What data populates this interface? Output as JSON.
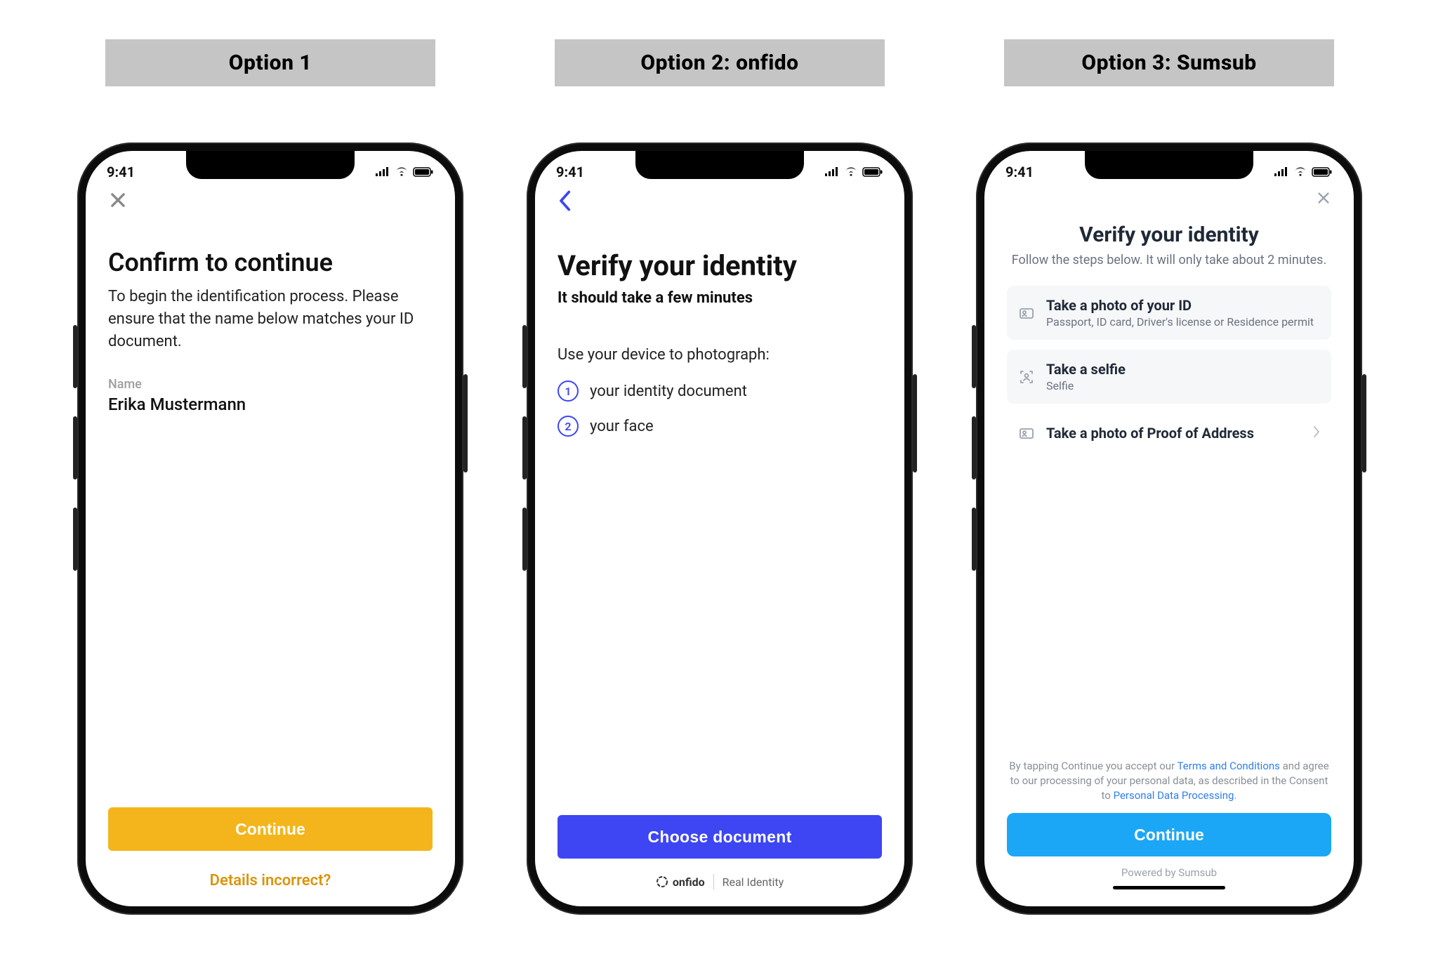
{
  "status": {
    "time": "9:41"
  },
  "options": {
    "opt1": {
      "label": "Option 1",
      "title": "Confirm to continue",
      "desc": "To begin the identification process. Please ensure that the name below matches your ID document.",
      "name_label": "Name",
      "name_value": "Erika Mustermann",
      "cta": "Continue",
      "secondary": "Details incorrect?"
    },
    "opt2": {
      "label": "Option 2: onfido",
      "title": "Verify your identity",
      "subtitle": "It should take a few minutes",
      "lead": "Use your device to photograph:",
      "steps": [
        "your identity document",
        "your face"
      ],
      "cta": "Choose document",
      "brand": "onfido",
      "brand_tag": "Real Identity"
    },
    "opt3": {
      "label": "Option 3: Sumsub",
      "title": "Verify your identity",
      "subtitle": "Follow the steps below. It will only take about 2 minutes.",
      "items": [
        {
          "title": "Take a photo of your ID",
          "sub": "Passport, ID card, Driver's license or Residence permit"
        },
        {
          "title": "Take a selfie",
          "sub": "Selfie"
        },
        {
          "title": "Take a photo of Proof of Address",
          "sub": ""
        }
      ],
      "legal_pre": "By tapping Continue you accept our ",
      "legal_terms": "Terms and Conditions",
      "legal_mid": " and agree to our processing of your personal data, as described in the Consent to ",
      "legal_priv": "Personal Data Processing",
      "legal_end": ".",
      "cta": "Continue",
      "powered": "Powered by Sumsub"
    }
  }
}
